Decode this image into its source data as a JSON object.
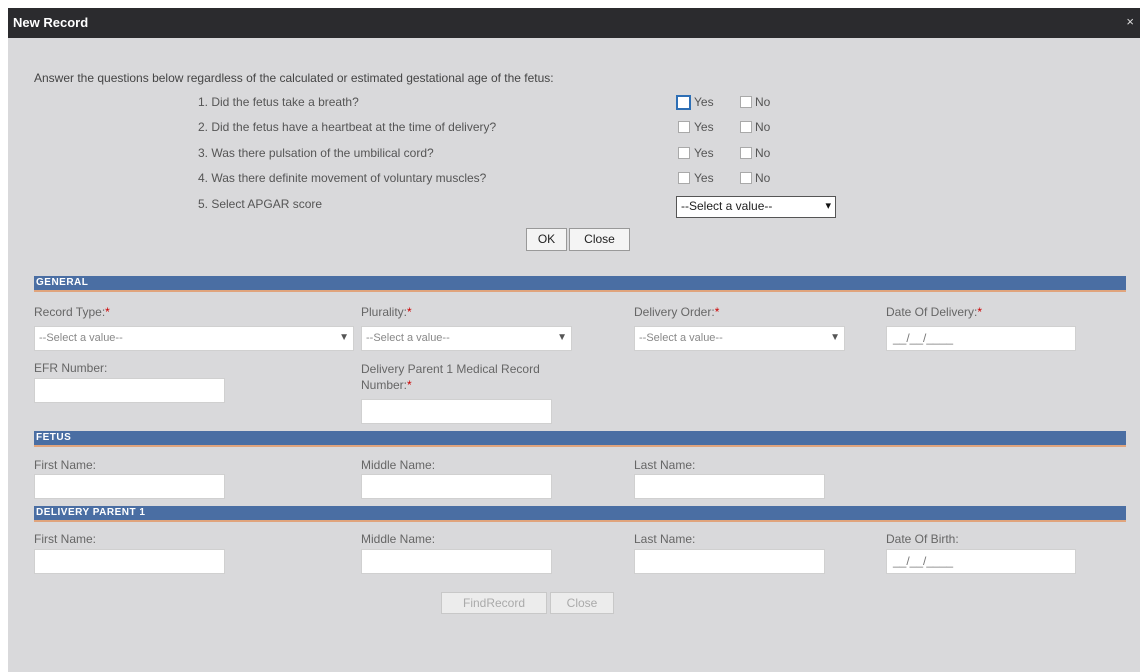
{
  "window": {
    "title": "New Record",
    "close_glyph": "×"
  },
  "screening": {
    "intro": "Answer the questions below regardless of the calculated or estimated gestational age of the fetus:",
    "questions": [
      "1. Did the fetus take a breath?",
      "2. Did the fetus have a heartbeat at the time of delivery?",
      "3. Was there pulsation of the umbilical cord?",
      "4. Was there definite movement of voluntary muscles?"
    ],
    "yes_label": "Yes",
    "no_label": "No",
    "apgar_label": "5. Select APGAR score",
    "apgar_value": "--Select a value--",
    "ok_label": "OK",
    "close_label": "Close"
  },
  "sections": {
    "general": "General",
    "fetus": "Fetus",
    "parent1": "Delivery Parent 1"
  },
  "general": {
    "record_type_label": "Record Type:",
    "record_type_value": "--Select a value--",
    "plurality_label": "Plurality:",
    "plurality_value": "--Select a value--",
    "delivery_order_label": "Delivery Order:",
    "delivery_order_value": "--Select a value--",
    "date_of_delivery_label": "Date Of Delivery:",
    "date_of_delivery_mask": "__/__/____",
    "efr_label": "EFR Number:",
    "mrn_label_line1": "Delivery Parent 1 Medical Record",
    "mrn_label_line2": "Number:",
    "required_mark": "*"
  },
  "fetus": {
    "first_name_label": "First Name:",
    "middle_name_label": "Middle Name:",
    "last_name_label": "Last Name:"
  },
  "parent1": {
    "first_name_label": "First Name:",
    "middle_name_label": "Middle Name:",
    "last_name_label": "Last Name:",
    "dob_label": "Date Of Birth:",
    "dob_mask": "__/__/____"
  },
  "footer": {
    "find_record_label": "FindRecord",
    "close_label": "Close"
  },
  "icons": {
    "dropdown_arrow": "chevron-down-icon",
    "close": "close-icon"
  },
  "colors": {
    "section_header": "#4a6ea3",
    "section_rule": "#e0a47c",
    "titlebar": "#2b2b2e",
    "required": "#cc0000"
  }
}
